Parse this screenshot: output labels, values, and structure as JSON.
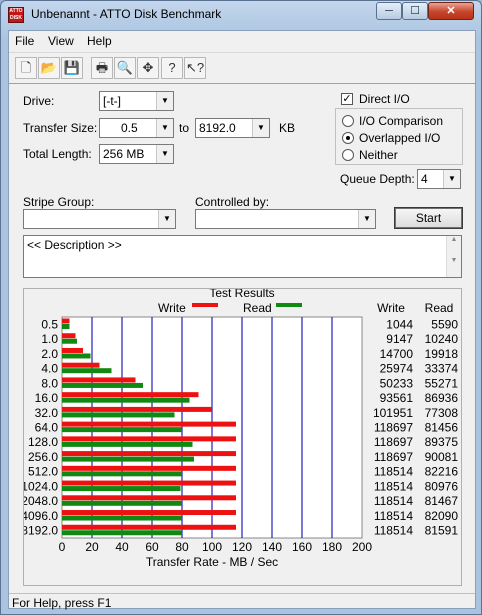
{
  "window": {
    "title": "Unbenannt - ATTO Disk Benchmark",
    "icon_text": "ATTO DISK BENCH",
    "minimize": "─",
    "maximize": "☐",
    "close": "✕"
  },
  "menu": {
    "items": [
      "File",
      "View",
      "Help"
    ]
  },
  "toolbar": {
    "buttons": [
      "new-document-icon",
      "open-folder-icon",
      "save-icon",
      "print-icon",
      "print-preview-icon",
      "move-icon",
      "help-question-icon",
      "context-help-icon"
    ]
  },
  "settings": {
    "drive_label": "Drive:",
    "drive_value": "[-t-]",
    "transfer_size_label": "Transfer Size:",
    "transfer_from": "0.5",
    "to_label": "to",
    "transfer_to": "8192.0",
    "kb_label": "KB",
    "total_length_label": "Total Length:",
    "total_length_value": "256 MB",
    "direct_io_label": "Direct I/O",
    "direct_io_checked": true,
    "io_comparison_label": "I/O Comparison",
    "overlapped_io_label": "Overlapped I/O",
    "neither_label": "Neither",
    "selected_mode": "Overlapped I/O",
    "queue_depth_label": "Queue Depth:",
    "queue_depth_value": "4",
    "stripe_group_label": "Stripe Group:",
    "stripe_group_value": "",
    "controlled_by_label": "Controlled by:",
    "controlled_by_value": "",
    "start_button": "Start",
    "description_text": "<< Description >>"
  },
  "results": {
    "title": "Test Results",
    "legend_write": "Write",
    "legend_read": "Read",
    "col_write": "Write",
    "col_read": "Read",
    "write_color": "#ee1111",
    "read_color": "#118811",
    "grid_color": "#2222bb"
  },
  "chart_data": {
    "type": "bar",
    "orientation": "horizontal",
    "categories": [
      "0.5",
      "1.0",
      "2.0",
      "4.0",
      "8.0",
      "16.0",
      "32.0",
      "64.0",
      "128.0",
      "256.0",
      "512.0",
      "1024.0",
      "2048.0",
      "4096.0",
      "8192.0"
    ],
    "series": [
      {
        "name": "Write",
        "values": [
          5,
          9,
          14,
          25,
          49,
          91,
          100,
          116,
          116,
          116,
          116,
          116,
          116,
          116,
          116
        ]
      },
      {
        "name": "Read",
        "values": [
          5,
          10,
          19,
          33,
          54,
          85,
          75,
          80,
          87,
          88,
          80,
          79,
          80,
          80,
          80
        ]
      }
    ],
    "write_values": [
      "1044",
      "9147",
      "14700",
      "25974",
      "50233",
      "93561",
      "101951",
      "118697",
      "118697",
      "118697",
      "118514",
      "118514",
      "118514",
      "118514",
      "118514"
    ],
    "read_values": [
      "5590",
      "10240",
      "19918",
      "33374",
      "55271",
      "86936",
      "77308",
      "81456",
      "89375",
      "90081",
      "82216",
      "80976",
      "81467",
      "82090",
      "81591"
    ],
    "xlabel": "Transfer Rate - MB / Sec",
    "xlim": [
      0,
      200
    ],
    "xticks": [
      "0",
      "20",
      "40",
      "60",
      "80",
      "100",
      "120",
      "140",
      "160",
      "180",
      "200"
    ],
    "grid": true,
    "legend": "top"
  },
  "status": {
    "text": "For Help, press F1"
  }
}
